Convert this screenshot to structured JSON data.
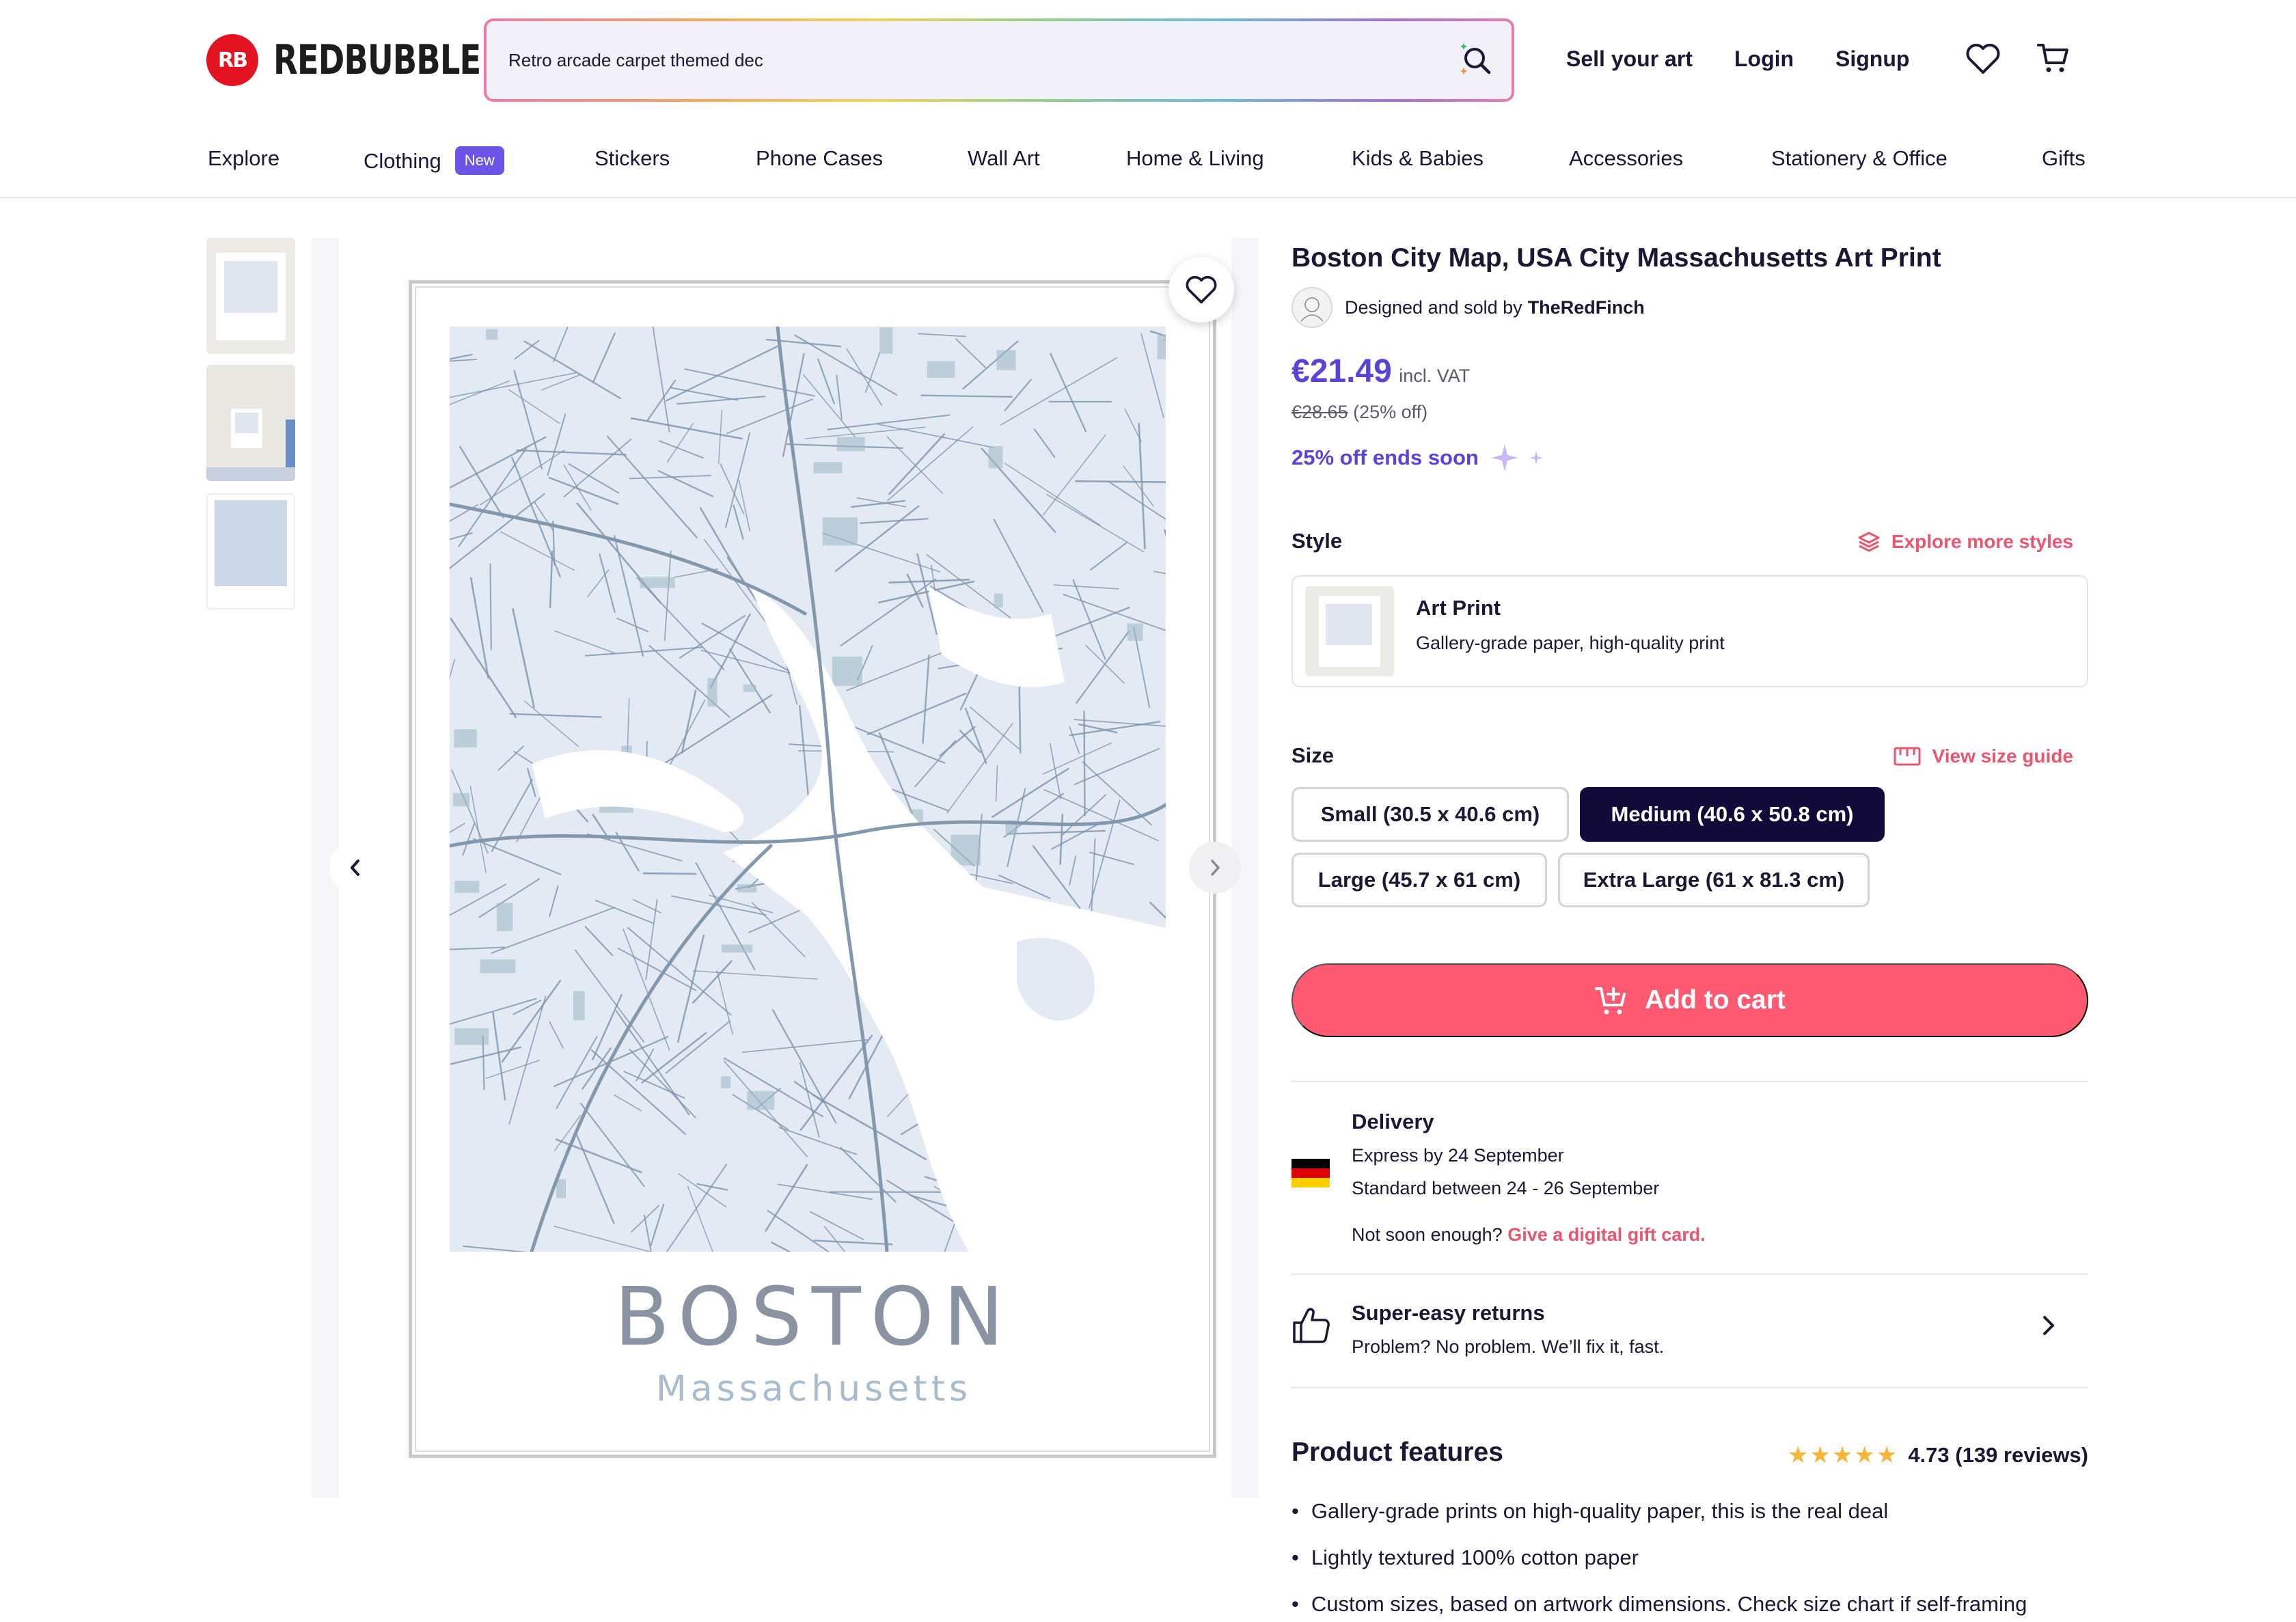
{
  "header": {
    "logo_mark": "RB",
    "logo_text": "REDBUBBLE",
    "search_value": "Retro arcade carpet themed dec",
    "sell_label": "Sell your art",
    "login_label": "Login",
    "signup_label": "Signup"
  },
  "nav": {
    "items": [
      "Explore",
      "Clothing",
      "Stickers",
      "Phone Cases",
      "Wall Art",
      "Home & Living",
      "Kids & Babies",
      "Accessories",
      "Stationery & Office",
      "Gifts"
    ],
    "new_badge": "New"
  },
  "poster": {
    "city": "BOSTON",
    "state": "Massachusetts"
  },
  "product": {
    "title": "Boston City Map, USA City Massachusetts Art Print",
    "designed_by": "Designed and sold by",
    "designer": "TheRedFinch",
    "price": "€21.49",
    "vat": "incl. VAT",
    "old_price": "€28.65",
    "discount": "(25% off)",
    "promo": "25% off ends soon"
  },
  "style": {
    "label": "Style",
    "explore_link": "Explore more styles",
    "name": "Art Print",
    "description": "Gallery-grade paper, high-quality print"
  },
  "size": {
    "label": "Size",
    "guide_link": "View size guide",
    "options": [
      "Small (30.5 x 40.6 cm)",
      "Medium (40.6 x 50.8 cm)",
      "Large (45.7 x 61 cm)",
      "Extra Large (61 x 81.3 cm)"
    ],
    "selected": "Medium (40.6 x 50.8 cm)"
  },
  "cart": {
    "label": "Add to cart"
  },
  "delivery": {
    "title": "Delivery",
    "express": "Express by 24 September",
    "standard": "Standard between 24 - 26 September",
    "not_soon": "Not soon enough?",
    "gift_link": "Give a digital gift card."
  },
  "returns": {
    "title": "Super-easy returns",
    "description": "Problem? No problem. We’ll fix it, fast."
  },
  "features": {
    "title": "Product features",
    "rating": "4.73 (139 reviews)",
    "rating_value": 4.73,
    "items": [
      "Gallery-grade prints on high-quality paper, this is the real deal",
      "Lightly textured 100% cotton paper",
      "Custom sizes, based on artwork dimensions. Check size chart if self-framing"
    ]
  },
  "colors": {
    "brand_red": "#e41321",
    "accent_purple": "#5a44d8",
    "cta_pink": "#ff5a72",
    "link_pink": "#e8566f",
    "selected_dark": "#120b3a"
  }
}
